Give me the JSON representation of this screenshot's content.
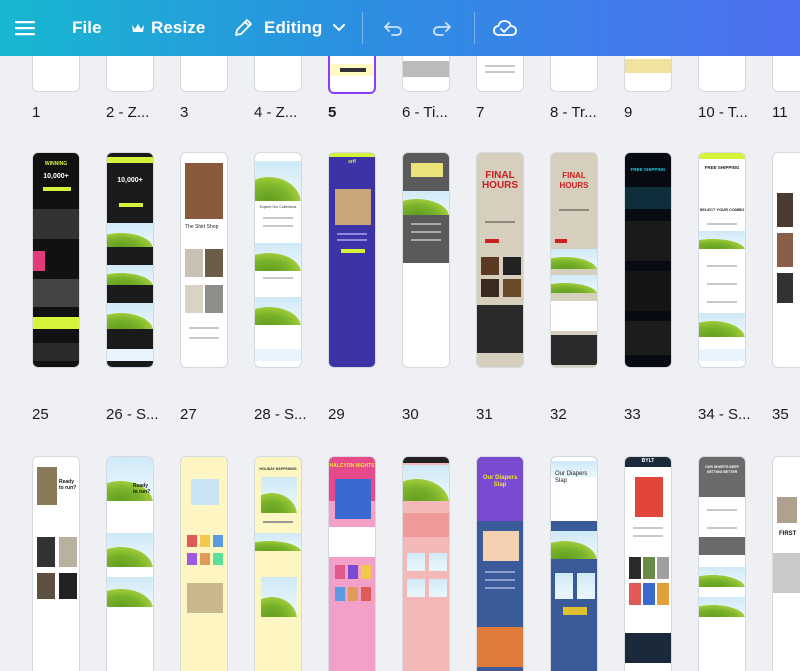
{
  "toolbar": {
    "file_label": "File",
    "resize_label": "Resize",
    "editing_label": "Editing",
    "colors": {
      "gradient_start": "#17b7cf",
      "gradient_end": "#4f6ff0"
    }
  },
  "pages": {
    "row1": [
      "1",
      "2 - Z...",
      "3",
      "4 - Z...",
      "5",
      "6 - Ti...",
      "7",
      "8 - Tr...",
      "9",
      "10 - T...",
      "11"
    ],
    "row2": [
      "25",
      "26 - S...",
      "27",
      "28 - S...",
      "29",
      "30",
      "31",
      "32",
      "33",
      "34 - S...",
      "35"
    ],
    "selected_page": "5"
  },
  "thumb_text": {
    "t25_head": "WINNING",
    "t25_big": "10,000+",
    "t26_big": "10,000+",
    "t27_shop": "The Shirt Shop",
    "t28_head": "Explore Our Collections",
    "t29_brand": "srif",
    "t31_title": "FINAL HOURS",
    "t32_title": "FINAL HOURS",
    "t33_head": "FREE SHIPPING",
    "t34_head": "FREE SHIPPING",
    "t34_sub": "SELECT YOUR COMBO",
    "r3_a_text": "Ready to run?",
    "r3_b_text": "Ready to run?",
    "r3_d_text": "HOLIDAY HAPPENING",
    "r3_e_text": "HALCYON NIGHTS",
    "r3_g_text": "Our Diapers Slap",
    "r3_h_text": "Our Diapers Slap",
    "r3_i_brand": "BYLT",
    "r3_j_text": "OUR SHORTS KEEP GETTING BETTER",
    "r3_k_text": "FIRST"
  },
  "icons": {
    "menu": "hamburger-menu-icon",
    "crown": "crown-icon",
    "pencil": "pencil-icon",
    "chevron": "chevron-down-icon",
    "undo": "undo-icon",
    "redo": "redo-icon",
    "cloud": "cloud-check-icon"
  }
}
